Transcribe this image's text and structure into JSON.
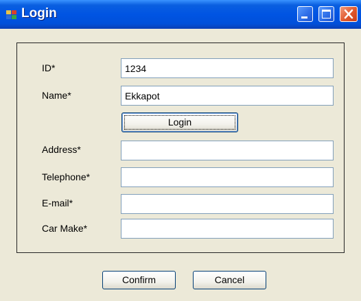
{
  "window": {
    "title": "Login",
    "colors": {
      "titlebar": "#0054E3",
      "face": "#ECE9D8",
      "close": "#E0582C"
    }
  },
  "form": {
    "fields": [
      {
        "label": "ID*",
        "value": "1234"
      },
      {
        "label": "Name*",
        "value": "Ekkapot"
      },
      {
        "label": "Address*",
        "value": ""
      },
      {
        "label": "Telephone*",
        "value": ""
      },
      {
        "label": "E-mail*",
        "value": ""
      },
      {
        "label": "Car Make*",
        "value": ""
      }
    ],
    "login_label": "Login"
  },
  "footer": {
    "confirm_label": "Confirm",
    "cancel_label": "Cancel"
  }
}
